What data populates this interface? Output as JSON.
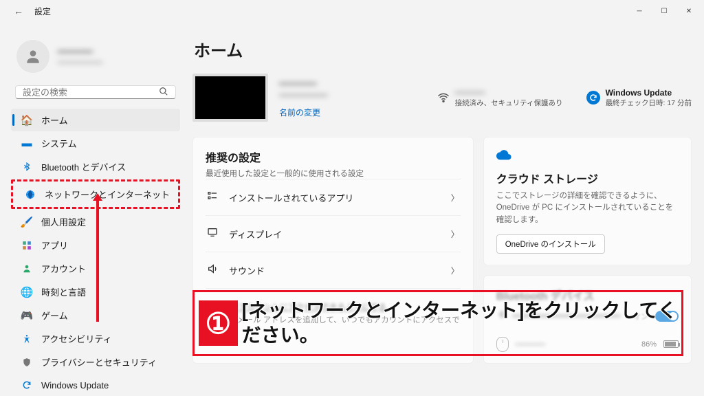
{
  "window": {
    "title": "設定",
    "back_aria": "戻る"
  },
  "user": {
    "name_blur": "━━━━━━",
    "email_blur": "━━━━━━━━━"
  },
  "search": {
    "placeholder": "設定の検索"
  },
  "nav": {
    "home": "ホーム",
    "system": "システム",
    "bluetooth": "Bluetooth とデバイス",
    "network": "ネットワークとインターネット",
    "personalization": "個人用設定",
    "apps": "アプリ",
    "accounts": "アカウント",
    "time_language": "時刻と言語",
    "gaming": "ゲーム",
    "accessibility": "アクセシビリティ",
    "privacy": "プライバシーとセキュリティ",
    "windows_update": "Windows Update"
  },
  "page": {
    "title": "ホーム",
    "rename": "名前の変更",
    "pc_name_blur": "━━━━━━",
    "pc_model_blur": "━━━━━━━━━"
  },
  "wifi": {
    "ssid_blur": "━━━━━━",
    "status": "接続済み、セキュリティ保護あり"
  },
  "wu": {
    "title": "Windows Update",
    "status": "最終チェック日時: 17 分前"
  },
  "recommended": {
    "title": "推奨の設定",
    "subtitle": "最近使用した設定と一般的に使用される設定",
    "items": {
      "installed_apps": "インストールされているアプリ",
      "display": "ディスプレイ",
      "sound": "サウンド"
    }
  },
  "cloud": {
    "title": "クラウド ストレージ",
    "desc": "ここでストレージの詳細を確認できるように、OneDrive が PC にインストールされていることを確認します。",
    "button": "OneDrive のインストール"
  },
  "bt_card": {
    "title_blur": "Bluetooth デバイス",
    "desc_blur": "━━━━━━━━━━━━━━━━━━━━",
    "toggle_label": "オン"
  },
  "recovery": {
    "title_blur": "引き続きアカウントにアクセスできるようにする",
    "desc": "回復用のメール アドレスを追加して、いつでもアカウントにアクセスできる"
  },
  "mouse": {
    "name_blur": "━━━━━━",
    "battery_pct": "86%"
  },
  "annotation": {
    "number": "①",
    "text": "[ネットワークとインターネット]をクリックしてください。"
  },
  "colors": {
    "accent": "#0067c0",
    "danger": "#e81123"
  }
}
